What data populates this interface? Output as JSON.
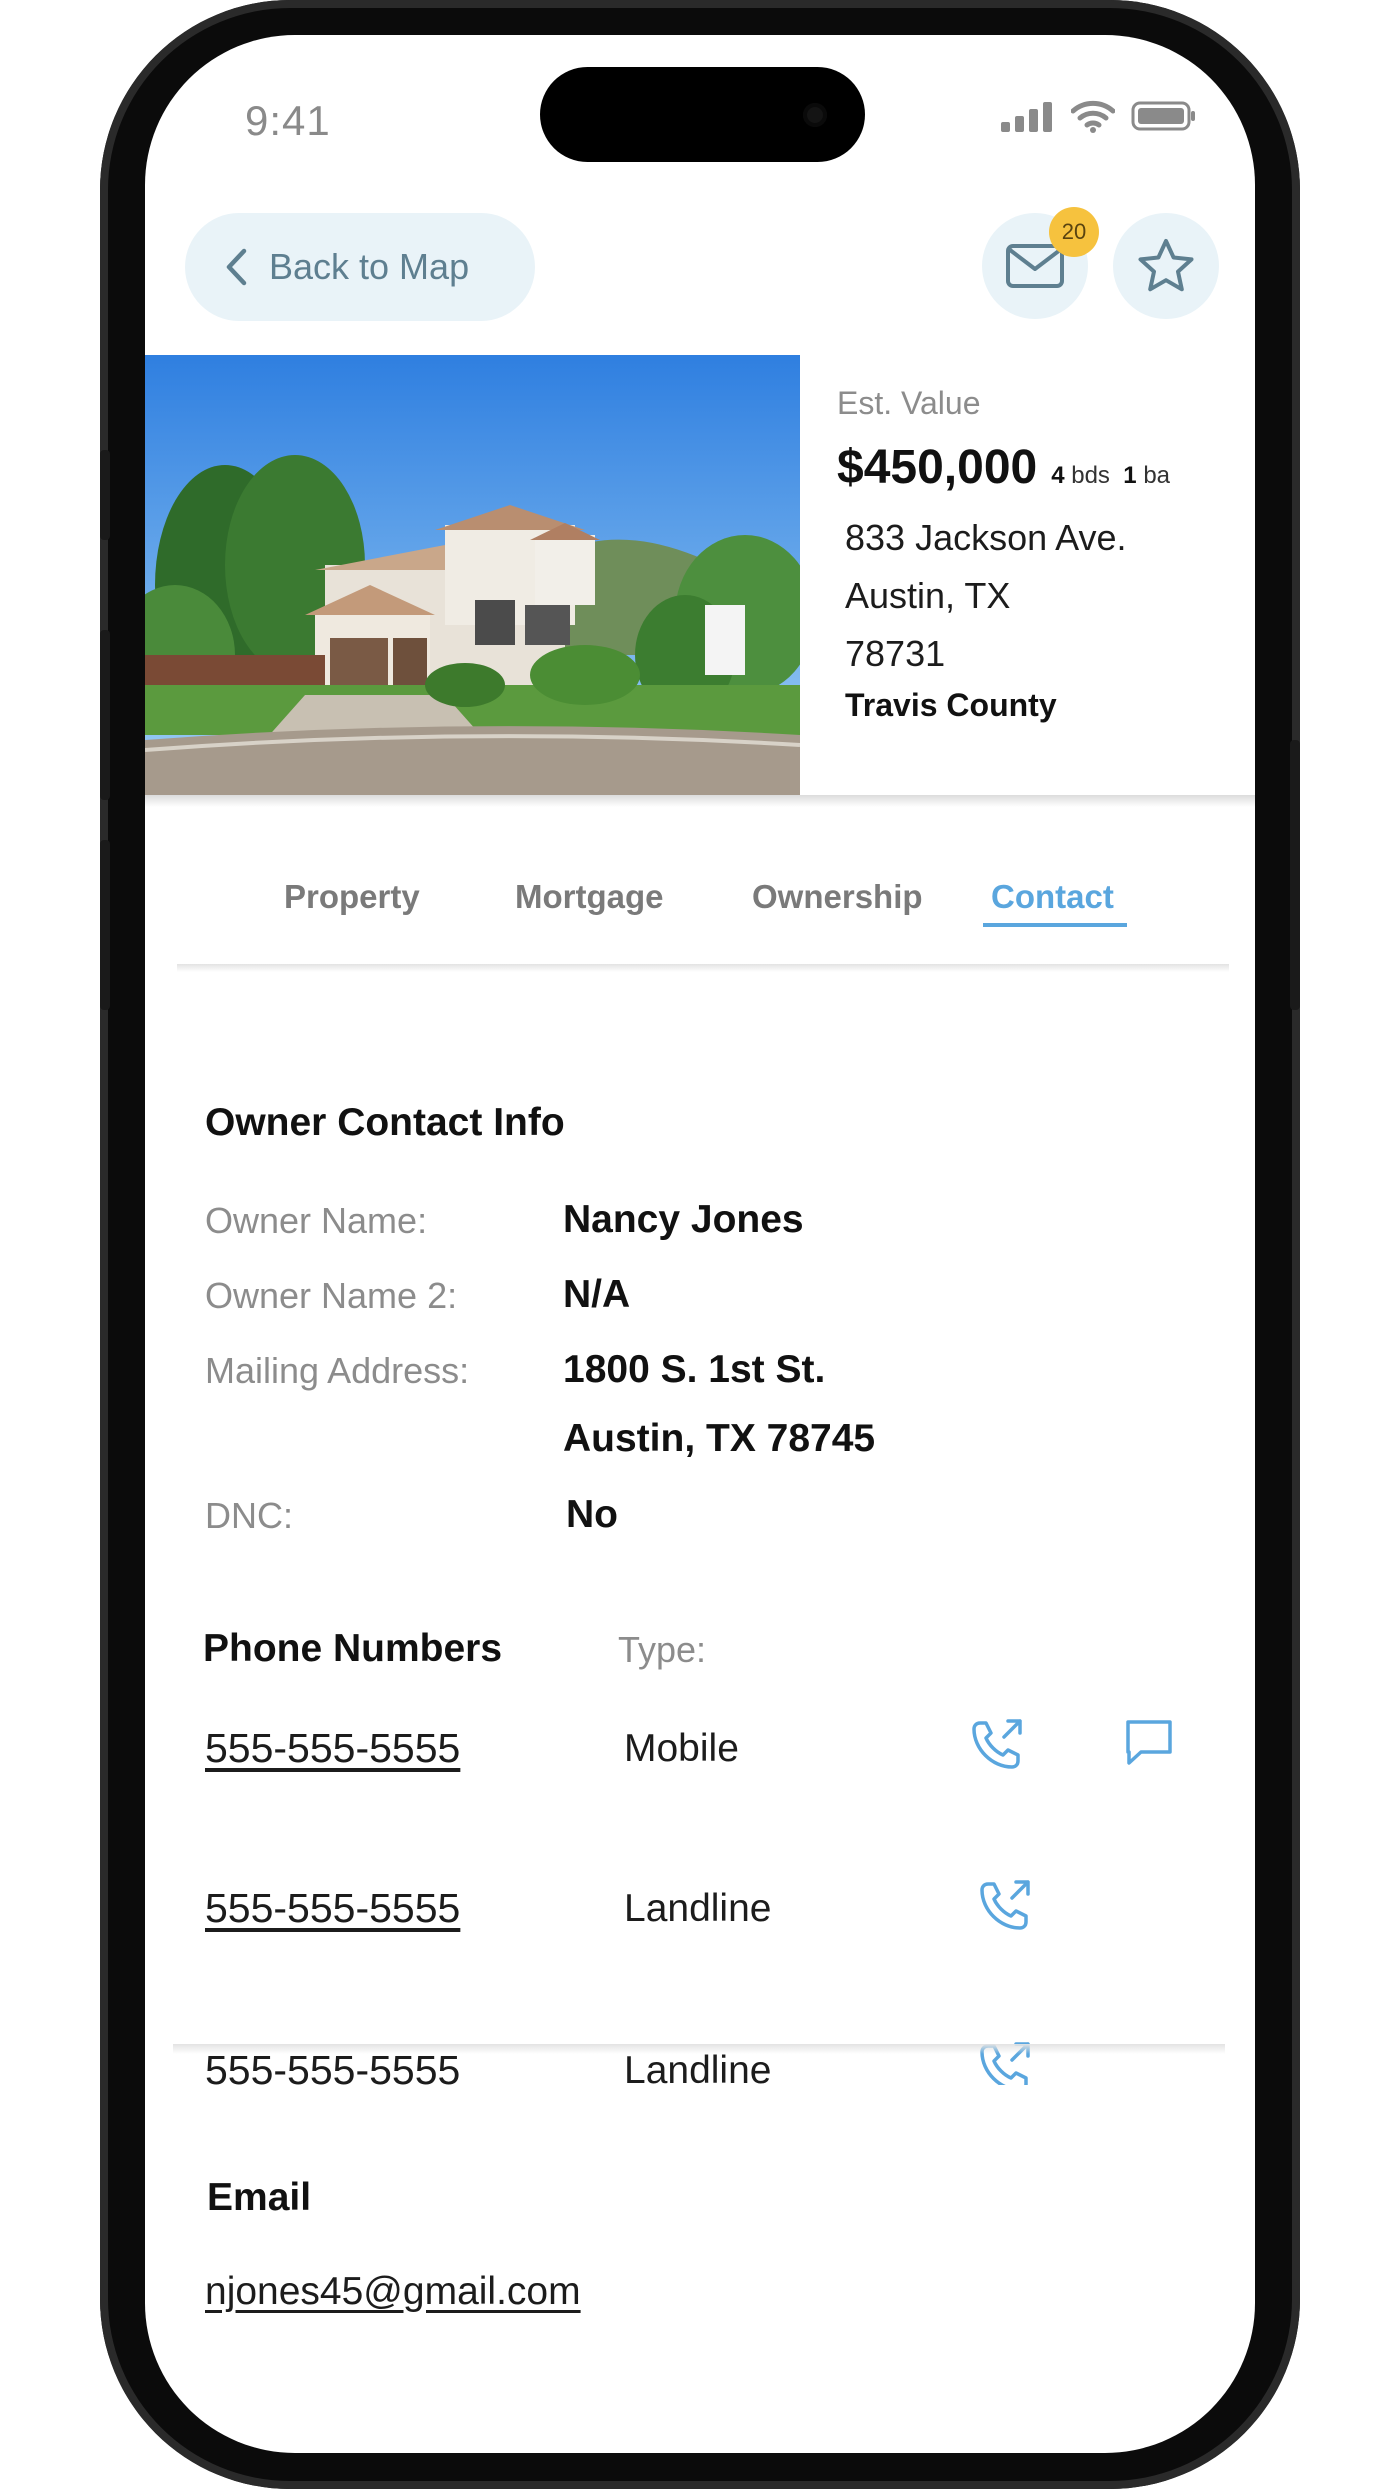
{
  "status_bar": {
    "time": "9:41"
  },
  "header": {
    "back_label": "Back to Map",
    "messages_badge": "20"
  },
  "property": {
    "est_label": "Est. Value",
    "price": "$450,000",
    "beds_num": "4",
    "beds_unit": "bds",
    "baths_num": "1",
    "baths_unit": "ba",
    "street": "833 Jackson Ave.",
    "city": "Austin, TX",
    "zip": "78731",
    "county": "Travis County"
  },
  "tabs": [
    {
      "label": "Property"
    },
    {
      "label": "Mortgage"
    },
    {
      "label": "Ownership"
    },
    {
      "label": "Contact",
      "active": true
    }
  ],
  "owner": {
    "title": "Owner Contact Info",
    "name_label": "Owner Name:",
    "name_value": "Nancy Jones",
    "name2_label": "Owner Name 2:",
    "name2_value": "N/A",
    "mailing_label": "Mailing Address:",
    "mailing_line1": "1800 S. 1st St.",
    "mailing_line2": "Austin, TX 78745",
    "dnc_label": "DNC:",
    "dnc_value": "No"
  },
  "phones": {
    "title": "Phone Numbers",
    "type_label": "Type:",
    "items": [
      {
        "number": "555-555-5555",
        "type": "Mobile"
      },
      {
        "number": "555-555-5555",
        "type": "Landline"
      },
      {
        "number": "555-555-5555",
        "type": "Landline"
      }
    ]
  },
  "email": {
    "title": "Email",
    "address": "njones45@gmail.com"
  },
  "colors": {
    "accent": "#5aa6de",
    "pill_bg": "#e9f3f8",
    "badge": "#f6c23e"
  }
}
